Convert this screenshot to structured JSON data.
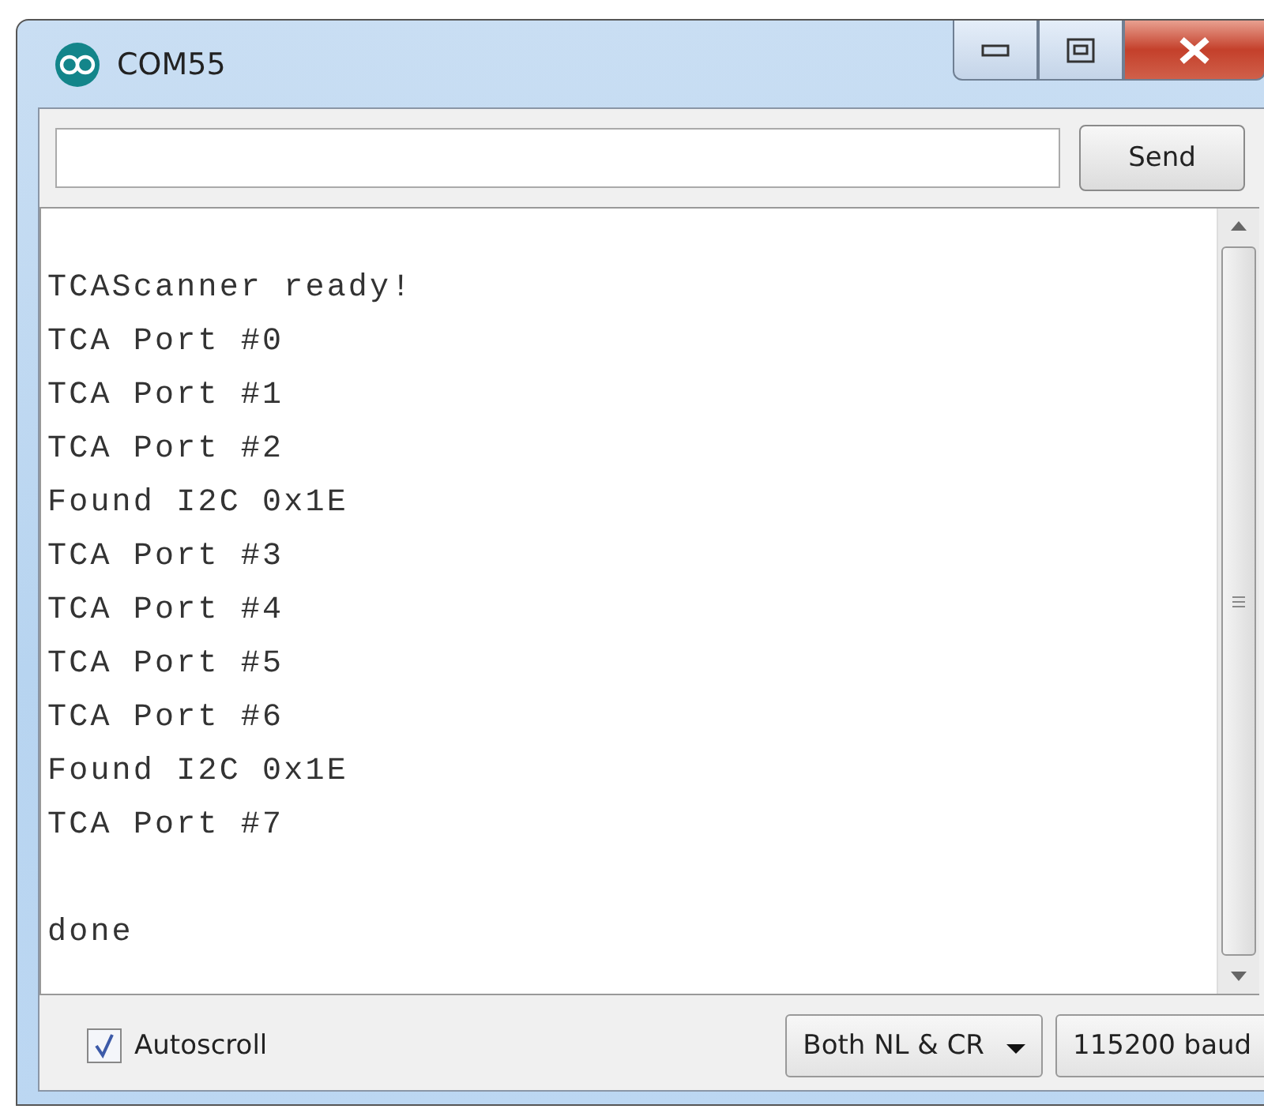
{
  "window": {
    "title": "COM55"
  },
  "send_button": "Send",
  "output": {
    "blocks": [
      {
        "lines": [
          "TCAScanner ready!",
          "TCA Port #0",
          "TCA Port #1",
          "TCA Port #2",
          "Found I2C 0x1E",
          "TCA Port #3",
          "TCA Port #4",
          "TCA Port #5",
          "TCA Port #6",
          "Found I2C 0x1E",
          "TCA Port #7"
        ]
      },
      {
        "lines": [
          "done"
        ]
      }
    ]
  },
  "autoscroll": {
    "label": "Autoscroll",
    "checked": true
  },
  "line_ending": "Both NL & CR",
  "baud": "115200 baud"
}
